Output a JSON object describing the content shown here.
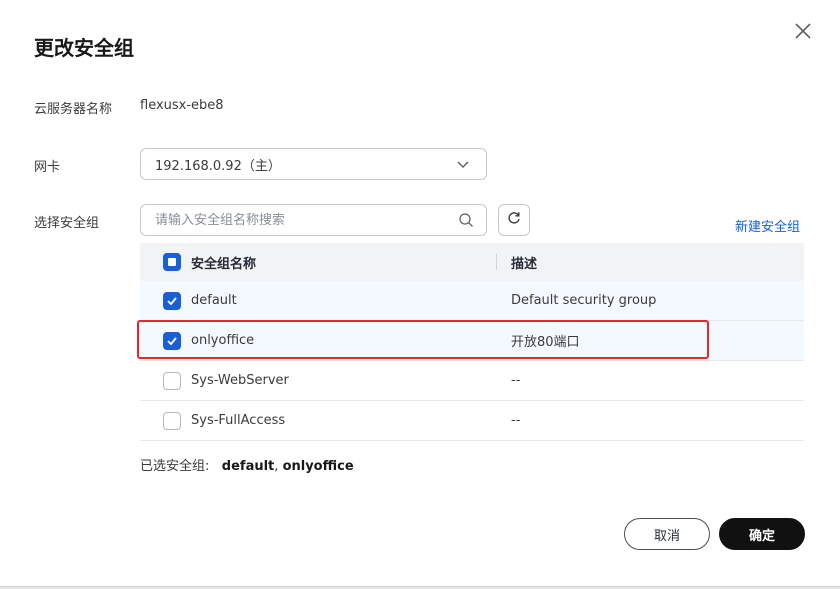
{
  "dialog": {
    "title": "更改安全组",
    "close_icon": "close-icon"
  },
  "fields": {
    "server_name_label": "云服务器名称",
    "server_name_value": "flexusx-ebe8",
    "nic_label": "网卡",
    "nic_value": "192.168.0.92（主）",
    "sg_label": "选择安全组"
  },
  "search": {
    "placeholder": "请输入安全组名称搜索",
    "value": ""
  },
  "new_sg_link": "新建安全组",
  "table": {
    "columns": [
      "安全组名称",
      "描述"
    ],
    "rows": [
      {
        "name": "default",
        "desc": "Default security group",
        "checked": true
      },
      {
        "name": "onlyoffice",
        "desc": "开放80端口",
        "checked": true
      },
      {
        "name": "Sys-WebServer",
        "desc": "--",
        "checked": false
      },
      {
        "name": "Sys-FullAccess",
        "desc": "--",
        "checked": false
      }
    ]
  },
  "selected": {
    "label": "已选安全组:",
    "items": [
      "default",
      "onlyoffice"
    ],
    "separator": ","
  },
  "buttons": {
    "cancel": "取消",
    "ok": "确定"
  },
  "colors": {
    "primary": "#1a5fd6",
    "link": "#0f62d6",
    "highlight_border": "#e8262b",
    "ok_button": "#111111"
  }
}
